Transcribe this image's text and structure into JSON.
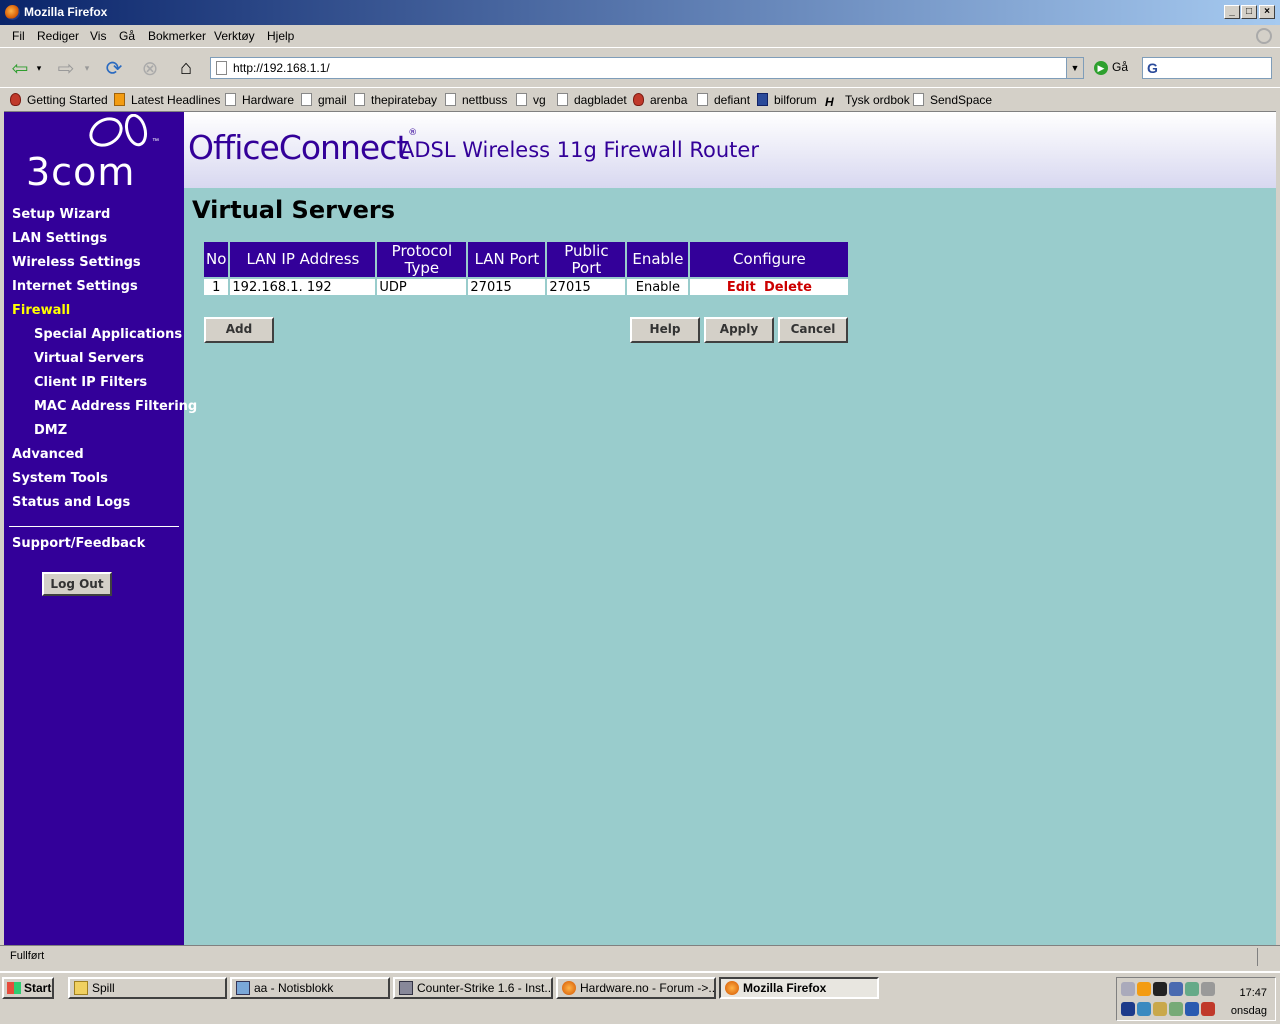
{
  "window": {
    "title": "Mozilla Firefox"
  },
  "menu": [
    "Fil",
    "Rediger",
    "Vis",
    "Gå",
    "Bokmerker",
    "Verktøy",
    "Hjelp"
  ],
  "nav": {
    "url": "http://192.168.1.1/",
    "go_label": "Gå"
  },
  "bookmarks": [
    "Getting Started",
    "Latest Headlines",
    "Hardware",
    "gmail",
    "thepiratebay",
    "nettbuss",
    "vg",
    "dagbladet",
    "arenba",
    "defiant",
    "bilforum",
    "Tysk ordbok",
    "SendSpace"
  ],
  "router": {
    "logo": "3com",
    "brand": "OfficeConnect",
    "brand_mark": "®",
    "product": "ADSL Wireless 11g Firewall Router",
    "sidebar": {
      "items": [
        "Setup Wizard",
        "LAN Settings",
        "Wireless Settings",
        "Internet Settings",
        "Firewall"
      ],
      "sub_items": [
        "Special Applications",
        "Virtual Servers",
        "Client IP Filters",
        "MAC Address Filtering",
        "DMZ"
      ],
      "items_after": [
        "Advanced",
        "System Tools",
        "Status and Logs"
      ],
      "support": "Support/Feedback",
      "logout": "Log Out"
    },
    "page_title": "Virtual Servers",
    "table": {
      "headers": [
        "No",
        "LAN IP Address",
        "Protocol Type",
        "LAN Port",
        "Public Port",
        "Enable",
        "Configure"
      ],
      "rows": [
        {
          "no": "1",
          "ip": "192.168.1. 192",
          "protocol": "UDP",
          "lan_port": "27015",
          "public_port": "27015",
          "enable": "Enable",
          "edit": "Edit",
          "delete": "Delete"
        }
      ]
    },
    "buttons": {
      "add": "Add",
      "help": "Help",
      "apply": "Apply",
      "cancel": "Cancel"
    }
  },
  "status": "Fullført",
  "taskbar": {
    "start": "Start",
    "tasks": [
      "Spill",
      "aa - Notisblokk",
      "Counter-Strike 1.6 - Inst...",
      "Hardware.no - Forum ->...",
      "Mozilla Firefox"
    ],
    "clock": "17:47",
    "day": "onsdag"
  },
  "colors": {
    "sidebar": "#330099",
    "content": "#99cccc",
    "active_nav": "#ffff00",
    "link": "#cc0000"
  }
}
